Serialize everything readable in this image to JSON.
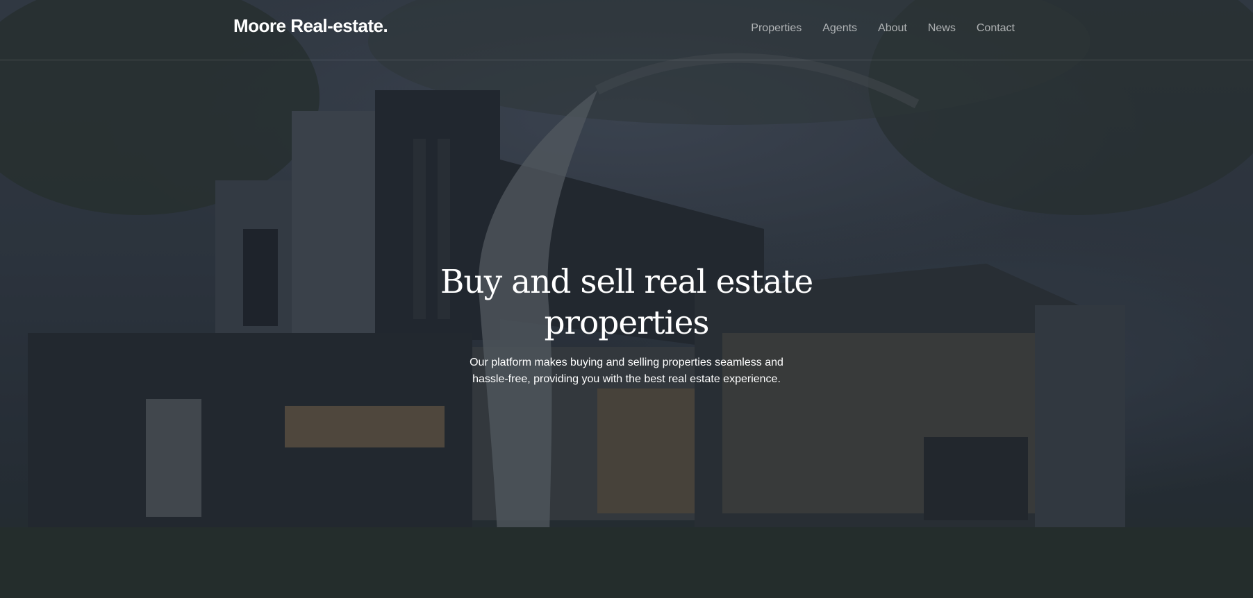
{
  "header": {
    "logo": "Moore Real-estate.",
    "nav": [
      {
        "label": "Properties"
      },
      {
        "label": "Agents"
      },
      {
        "label": "About"
      },
      {
        "label": "News"
      },
      {
        "label": "Contact"
      }
    ]
  },
  "hero": {
    "title": "Buy and sell real estate properties",
    "subtitle": "Our platform makes buying and selling properties seamless and hassle-free, providing you with the best real estate experience.",
    "background_icon": "modern-house-photo"
  },
  "colors": {
    "text": "#ffffff",
    "nav_text": "#a7abb1",
    "overlay": "#2a303a"
  }
}
